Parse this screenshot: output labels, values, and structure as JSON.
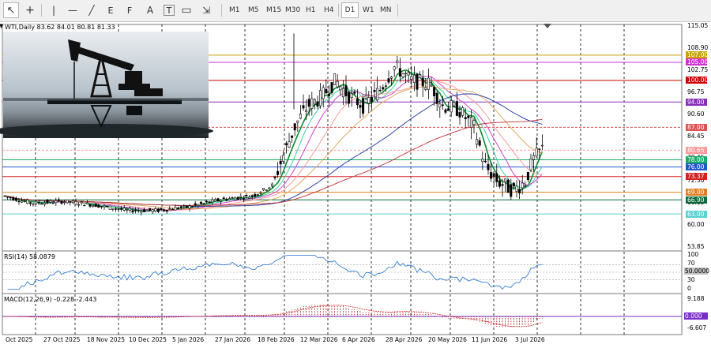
{
  "toolbar": {
    "tools": [
      {
        "name": "cursor-tool",
        "glyph": "↖"
      },
      {
        "name": "crosshair-tool",
        "glyph": "+"
      },
      {
        "name": "vertical-line-tool",
        "glyph": "|"
      },
      {
        "name": "horizontal-line-tool",
        "glyph": "—"
      },
      {
        "name": "trendline-tool",
        "glyph": "╱"
      },
      {
        "name": "equidistant-channel-tool",
        "glyph": "E"
      },
      {
        "name": "fibonacci-tool",
        "glyph": "F"
      },
      {
        "name": "text-tool",
        "glyph": "A"
      },
      {
        "name": "label-tool",
        "glyph": "T"
      },
      {
        "name": "shapes-tool",
        "glyph": "▭"
      },
      {
        "name": "arrows-tool",
        "glyph": "⇲"
      }
    ],
    "timeframes": [
      "M1",
      "M5",
      "M15",
      "M30",
      "H1",
      "H4",
      "D1",
      "W1",
      "MN"
    ],
    "active_timeframe": "D1"
  },
  "chart": {
    "header": "WTI,Daily  83.62 84.01 80.81 81.33",
    "price_axis": [
      "115.05",
      "108.90",
      "102.75",
      "96.75",
      "90.60",
      "84.45",
      "78.45",
      "72.30",
      "66.15",
      "60.00",
      "53.85"
    ],
    "levels": [
      {
        "label": "107.00",
        "color": "#c8a000"
      },
      {
        "label": "105.00",
        "color": "#cc33cc"
      },
      {
        "label": "100.00",
        "color": "#cc0000"
      },
      {
        "label": "94.00",
        "color": "#8a2bb8"
      },
      {
        "label": "87.00",
        "color": "#e05050"
      },
      {
        "label": "80.65",
        "color": "#ff9999"
      },
      {
        "label": "78.00",
        "color": "#1aaa66"
      },
      {
        "label": "76.00",
        "color": "#2255cc"
      },
      {
        "label": "73.37",
        "color": "#d62020"
      },
      {
        "label": "69.00",
        "color": "#e08020"
      },
      {
        "label": "66.90",
        "color": "#0b6b3a"
      },
      {
        "label": "63.00",
        "color": "#5ad0d0"
      }
    ],
    "rsi": {
      "header": "RSI(14) 58.0879",
      "axis": [
        "100",
        "70",
        "50.0000",
        "30",
        "0"
      ]
    },
    "macd": {
      "header": "MACD(12,26,9) -0.228 -2.443",
      "axis": [
        "9.188",
        "0.000",
        "-6.607"
      ]
    },
    "dates": [
      "Oct 2025",
      "27 Oct 2025",
      "18 Nov 2025",
      "10 Dec 2025",
      "5 Jan 2026",
      "27 Jan 2026",
      "18 Feb 2026",
      "12 Mar 2026",
      "6 Apr 2026",
      "28 Apr 2026",
      "20 May 2026",
      "11 Jun 2026",
      "3 Jul 2026"
    ]
  }
}
